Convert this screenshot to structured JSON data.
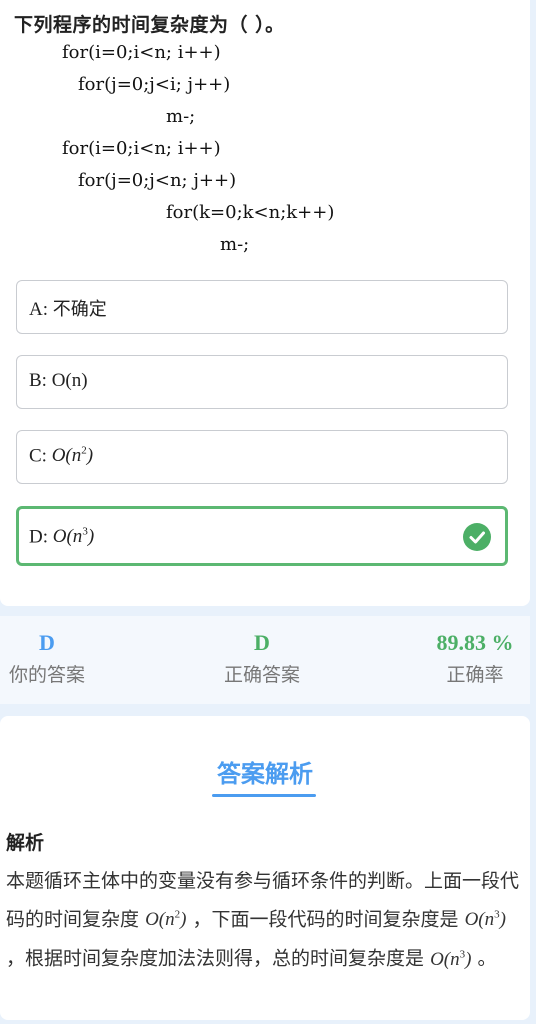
{
  "question": {
    "title": "下列程序的时间复杂度为（ ）。",
    "code": [
      "for(i=0;i<n; i++)",
      "for(j=0;j<i; j++)",
      "m-;",
      "for(i=0;i<n; i++)",
      "for(j=0;j<n; j++)",
      "for(k=0;k<n;k++)",
      "m-;"
    ]
  },
  "options": [
    {
      "letter": "A:",
      "text": "不确定"
    },
    {
      "letter": "B:",
      "text": "O(n)"
    },
    {
      "letter": "C:",
      "text": "O(n",
      "exp": "2",
      "close": ")"
    },
    {
      "letter": "D:",
      "text": "O(n",
      "exp": "3",
      "close": ")"
    }
  ],
  "stats": {
    "your_answer": "D",
    "your_answer_label": "你的答案",
    "correct_answer": "D",
    "correct_answer_label": "正确答案",
    "accuracy": "89.83 %",
    "accuracy_label": "正确率"
  },
  "analysis": {
    "heading": "答案解析",
    "title": "解析",
    "p1": "本题循环主体中的变量没有参与循环条件的判断。上面一段代码的时间复杂度",
    "m1": "O(n",
    "m1exp": "2",
    "m1close": ")",
    "p2": "，下面一段代码的时间复杂度是",
    "m2": "O(n",
    "m2exp": "3",
    "m2close": ")",
    "p3": "，根据时间复杂度加法法则得，总的时间复杂度是",
    "m3": "O(n",
    "m3exp": "3",
    "m3close": ")",
    "p4": "。"
  },
  "colors": {
    "accent": "#4b9cf0",
    "correct": "#4caf66",
    "accuracy": "#4caf66",
    "background": "#e8f1fb"
  }
}
